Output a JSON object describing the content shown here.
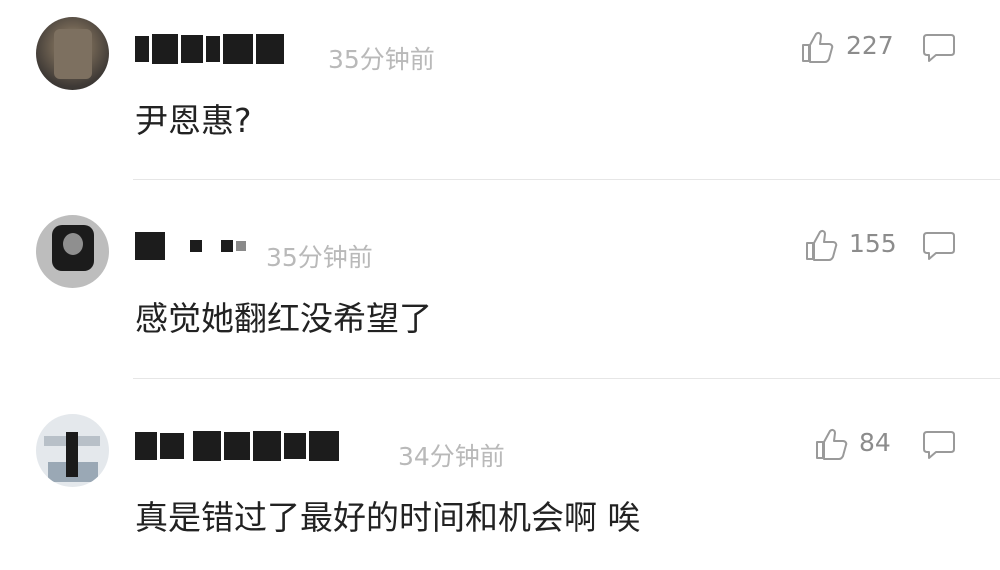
{
  "comments": [
    {
      "username": "",
      "time": "35分钟前",
      "likes": "227",
      "text": "尹恩惠?"
    },
    {
      "username": "",
      "time": "35分钟前",
      "likes": "155",
      "text": "感觉她翻红没希望了"
    },
    {
      "username": "",
      "time": "34分钟前",
      "likes": "84",
      "text": "真是错过了最好的时间和机会啊 唉"
    }
  ],
  "icons": {
    "like": "thumbs-up-icon",
    "reply": "comment-bubble-icon"
  },
  "colors": {
    "text": "#222222",
    "meta": "#b9b9b9",
    "count": "#8c8c8c",
    "icon": "#9a9a9a",
    "divider": "#e6e6e6"
  }
}
